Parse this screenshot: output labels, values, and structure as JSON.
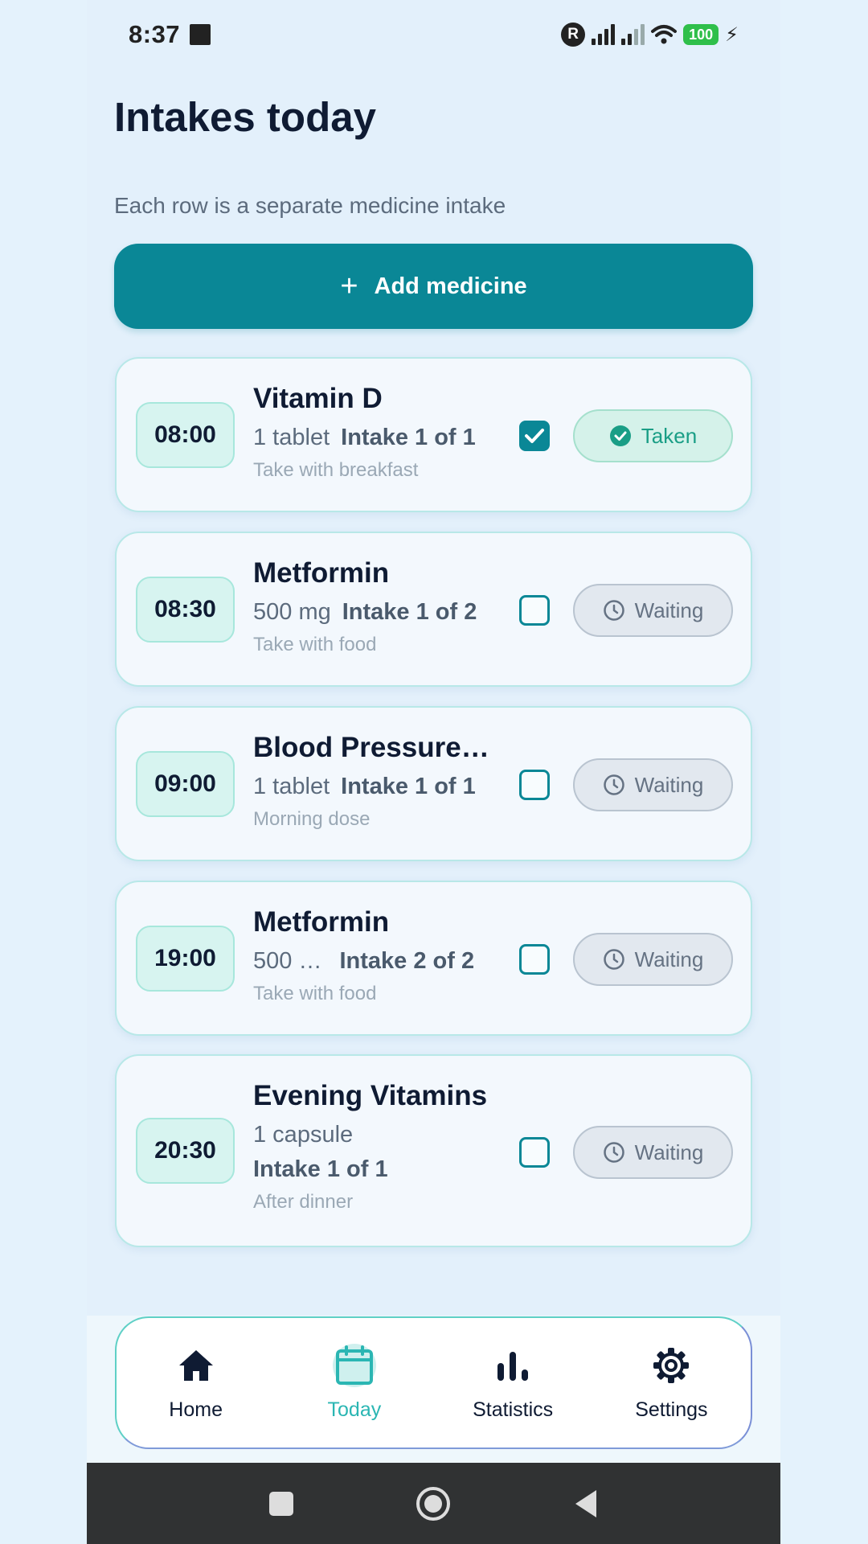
{
  "status_bar": {
    "time": "8:37",
    "r_badge": "R",
    "battery": "100"
  },
  "header": {
    "title": "Intakes today",
    "subtitle": "Each row is a separate medicine intake"
  },
  "add_button": {
    "label": "Add medicine",
    "icon": "plus-icon"
  },
  "intakes": [
    {
      "time": "08:00",
      "name": "Vitamin D",
      "dose": "1 tablet",
      "intake": "Intake 1 of 1",
      "note": "Take with breakfast",
      "checked": true,
      "status": "Taken"
    },
    {
      "time": "08:30",
      "name": "Metformin",
      "dose": "500 mg",
      "intake": "Intake 1 of 2",
      "note": "Take with food",
      "checked": false,
      "status": "Waiting"
    },
    {
      "time": "09:00",
      "name": "Blood Pressure…",
      "dose": "1 tablet",
      "intake": "Intake 1 of 1",
      "note": "Morning dose",
      "checked": false,
      "status": "Waiting"
    },
    {
      "time": "19:00",
      "name": "Metformin",
      "dose": "500 …",
      "intake": "Intake 2 of 2",
      "note": "Take with food",
      "checked": false,
      "status": "Waiting"
    },
    {
      "time": "20:30",
      "name": "Evening Vitamins",
      "dose": "1 capsule",
      "intake": "Intake 1 of 1",
      "note": "After dinner",
      "checked": false,
      "status": "Waiting"
    }
  ],
  "nav": {
    "items": [
      {
        "label": "Home",
        "icon": "home-icon"
      },
      {
        "label": "Today",
        "icon": "calendar-icon",
        "active": true
      },
      {
        "label": "Statistics",
        "icon": "bar-chart-icon"
      },
      {
        "label": "Settings",
        "icon": "gear-icon"
      }
    ]
  },
  "colors": {
    "accent": "#0a8796",
    "active_nav": "#2bb6b3",
    "taken": "#1a9e86",
    "waiting": "#657283"
  }
}
